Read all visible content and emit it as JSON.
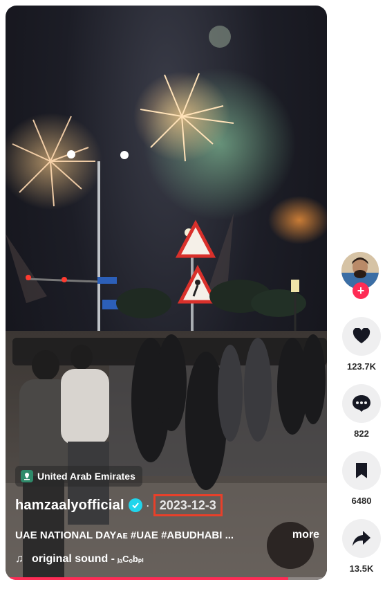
{
  "video": {
    "location": "United Arab Emirates",
    "author": "hamzaalyofficial",
    "date": "2023-12-3",
    "description": "UAE NATIONAL DAYᴀᴇ #UAE #ABUDHABI ...",
    "more_label": "more",
    "sound": "original sound - ",
    "sound_artist": "ⱼₐCₒbₚₗ",
    "progress": 0.88
  },
  "actions": {
    "likes": "123.7K",
    "comments": "822",
    "saves": "6480",
    "shares": "13.5K"
  },
  "colors": {
    "accent": "#fe2c55",
    "verified": "#20d5ec",
    "highlight_box": "#e8402a"
  }
}
